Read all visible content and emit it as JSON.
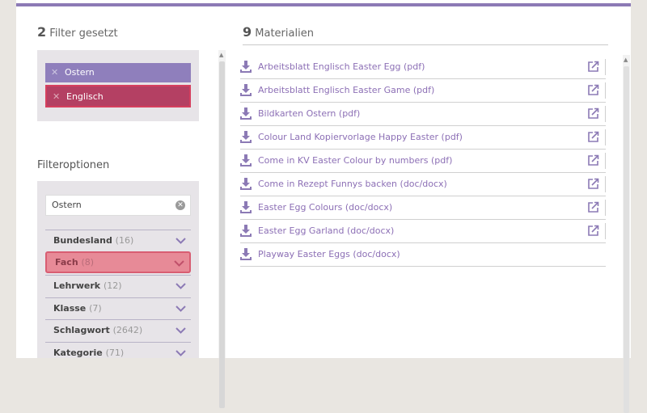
{
  "filters": {
    "count": "2",
    "label": "Filter gesetzt",
    "active": [
      {
        "label": "Ostern"
      },
      {
        "label": "Englisch"
      }
    ]
  },
  "options": {
    "title": "Filteroptionen",
    "search_value": "Ostern",
    "facets": [
      {
        "label": "Bundesland",
        "count": "(16)"
      },
      {
        "label": "Fach",
        "count": "(8)"
      },
      {
        "label": "Lehrwerk",
        "count": "(12)"
      },
      {
        "label": "Klasse",
        "count": "(7)"
      },
      {
        "label": "Schlagwort",
        "count": "(2642)"
      },
      {
        "label": "Kategorie",
        "count": "(71)"
      }
    ]
  },
  "materials": {
    "count": "9",
    "label": "Materialien",
    "items": [
      {
        "label": "Arbeitsblatt Englisch Easter Egg (pdf)",
        "external": true
      },
      {
        "label": "Arbeitsblatt Englisch Easter Game (pdf)",
        "external": true
      },
      {
        "label": "Bildkarten Ostern (pdf)",
        "external": true
      },
      {
        "label": "Colour Land Kopiervorlage Happy Easter (pdf)",
        "external": true
      },
      {
        "label": "Come in KV Easter Colour by numbers (pdf)",
        "external": true
      },
      {
        "label": "Come in Rezept Funnys backen (doc/docx)",
        "external": true
      },
      {
        "label": "Easter Egg Colours (doc/docx)",
        "external": true
      },
      {
        "label": "Easter Egg Garland (doc/docx)",
        "external": true
      },
      {
        "label": "Playway Easter Eggs (doc/docx)",
        "external": false
      }
    ]
  },
  "colors": {
    "accent": "#8c7ab5",
    "chip_active": "#8f7fbc",
    "chip_highlight": "#b44063",
    "facet_highlight": "#e78a97",
    "link": "#8c6fb5"
  }
}
